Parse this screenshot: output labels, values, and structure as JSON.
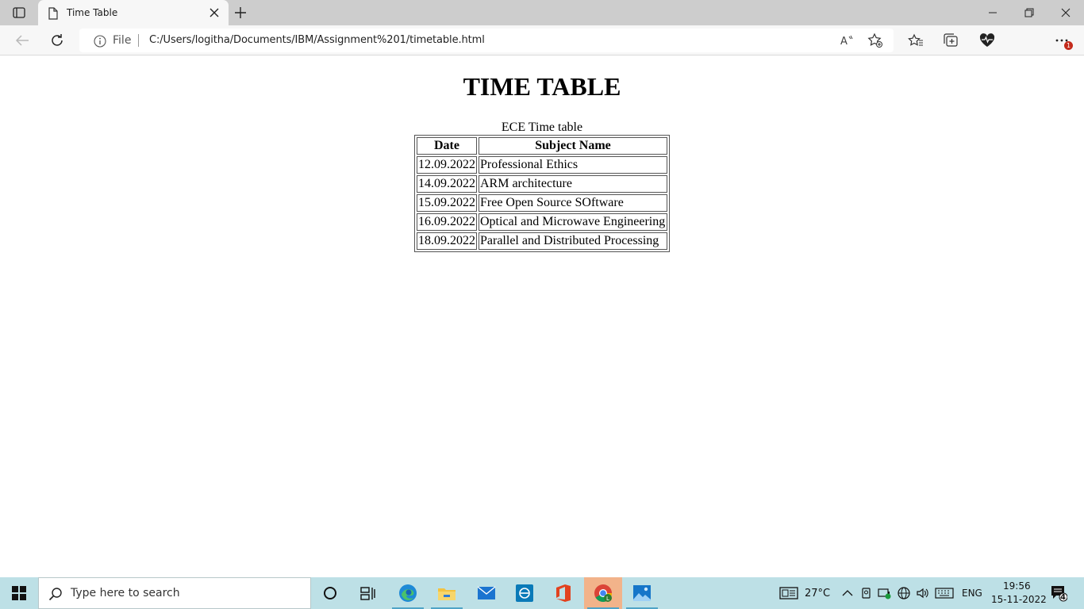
{
  "browser": {
    "tab_title": "Time Table",
    "site_label": "File",
    "url": "C:/Users/logitha/Documents/IBM/Assignment%201/timetable.html",
    "notification_count": "1"
  },
  "page": {
    "heading": "TIME TABLE",
    "caption": "ECE Time table",
    "columns": [
      "Date",
      "Subject Name"
    ],
    "rows": [
      [
        "12.09.2022",
        "Professional Ethics"
      ],
      [
        "14.09.2022",
        "ARM architecture"
      ],
      [
        "15.09.2022",
        "Free Open Source SOftware"
      ],
      [
        "16.09.2022",
        "Optical and Microwave Engineering"
      ],
      [
        "18.09.2022",
        "Parallel and Distributed Processing"
      ]
    ]
  },
  "taskbar": {
    "search_placeholder": "Type here to search",
    "weather": "27°C",
    "language": "ENG",
    "time": "19:56",
    "date": "15-11-2022",
    "notification_count": "4",
    "apps": [
      "task-view",
      "edge",
      "file-explorer",
      "mail",
      "dell-app",
      "office",
      "chrome",
      "photos"
    ]
  },
  "colors": {
    "tabstrip_bg": "#cdcdcd",
    "toolbar_bg": "#f7f7f7",
    "taskbar_bg": "#bde0e6",
    "badge_red": "#c42b1c",
    "chrome_highlight": "#f2b38a"
  }
}
